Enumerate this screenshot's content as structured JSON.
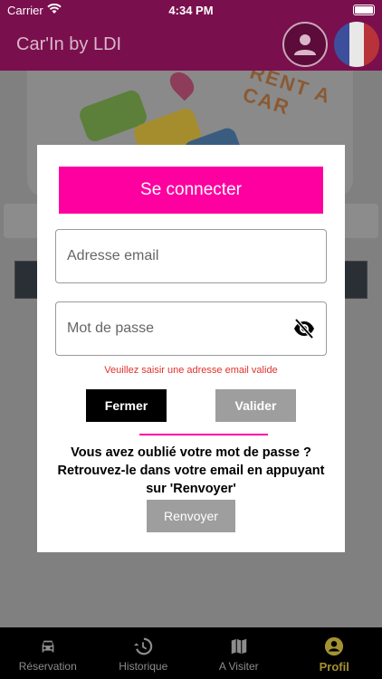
{
  "status_bar": {
    "carrier": "Carrier",
    "time": "4:34 PM"
  },
  "app_bar": {
    "title": "Car'In by LDI"
  },
  "banner": {
    "text": "RENT A CAR"
  },
  "modal": {
    "title": "Se connecter",
    "email_placeholder": "Adresse email",
    "password_placeholder": "Mot de passe",
    "error": "Veuillez saisir une adresse email valide",
    "close_label": "Fermer",
    "validate_label": "Valider",
    "forgot_line1": "Vous avez oublié votre mot de passe ?",
    "forgot_line2": "Retrouvez-le dans votre email en appuyant",
    "forgot_line3": "sur 'Renvoyer'",
    "resend_label": "Renvoyer"
  },
  "bottom_nav": [
    {
      "label": "Réservation",
      "icon": "car-icon"
    },
    {
      "label": "Historique",
      "icon": "history-icon"
    },
    {
      "label": "A Visiter",
      "icon": "map-icon"
    },
    {
      "label": "Profil",
      "icon": "profile-icon",
      "active": true
    }
  ],
  "colors": {
    "primary": "#7a0f4e",
    "accent": "#ff00a0",
    "active_nav": "#a39233",
    "error": "#e0312b"
  }
}
